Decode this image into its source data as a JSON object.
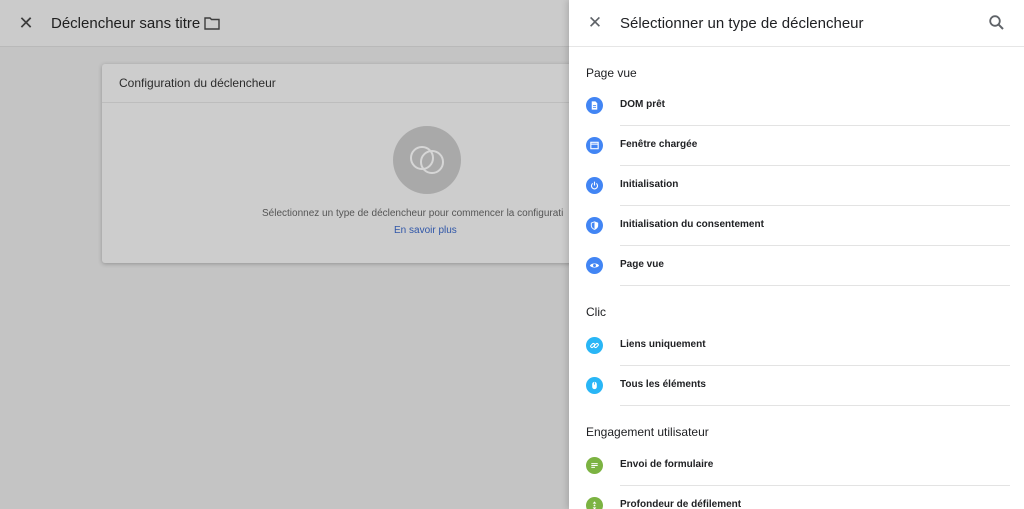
{
  "editor": {
    "title": "Déclencheur sans titre",
    "card_title": "Configuration du déclencheur",
    "hint": "Sélectionnez un type de déclencheur pour commencer la configurati",
    "link": "En savoir plus"
  },
  "panel": {
    "title": "Sélectionner un type de déclencheur",
    "sections": [
      {
        "title": "Page vue",
        "items": [
          {
            "label": "DOM prêt",
            "icon": "document-icon",
            "color": "#4285f4"
          },
          {
            "label": "Fenêtre chargée",
            "icon": "window-icon",
            "color": "#4285f4"
          },
          {
            "label": "Initialisation",
            "icon": "power-icon",
            "color": "#4285f4"
          },
          {
            "label": "Initialisation du consentement",
            "icon": "shield-icon",
            "color": "#4285f4"
          },
          {
            "label": "Page vue",
            "icon": "eye-icon",
            "color": "#4285f4"
          }
        ]
      },
      {
        "title": "Clic",
        "items": [
          {
            "label": "Liens uniquement",
            "icon": "link-icon",
            "color": "#29b6f6"
          },
          {
            "label": "Tous les éléments",
            "icon": "mouse-icon",
            "color": "#29b6f6"
          }
        ]
      },
      {
        "title": "Engagement utilisateur",
        "items": [
          {
            "label": "Envoi de formulaire",
            "icon": "form-icon",
            "color": "#7cb342"
          },
          {
            "label": "Profondeur de défilement",
            "icon": "scroll-icon",
            "color": "#7cb342"
          }
        ]
      }
    ]
  }
}
